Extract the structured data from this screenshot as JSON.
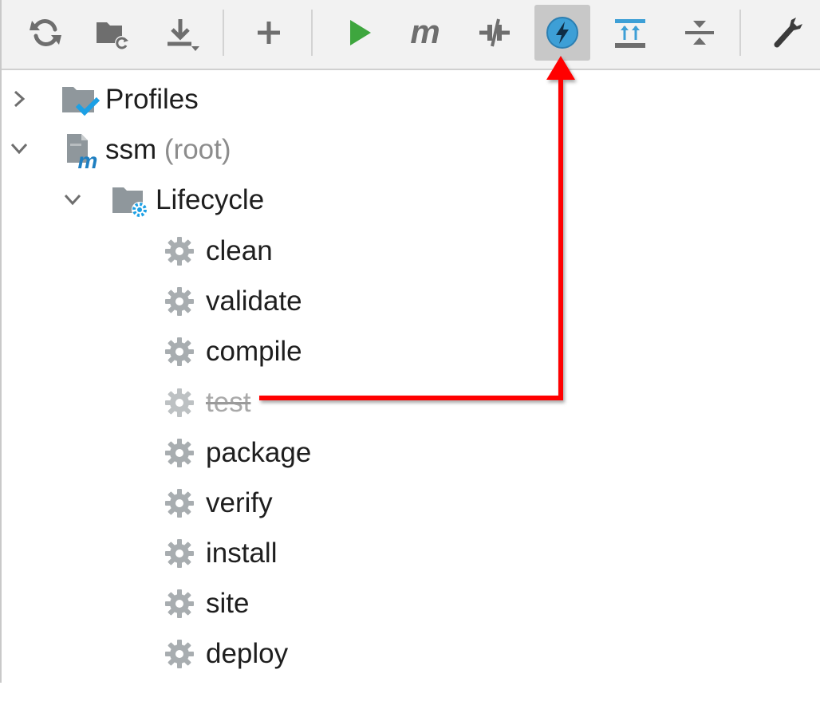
{
  "toolbar": {
    "buttons": [
      {
        "name": "reload-all-projects-button",
        "icon": "refresh-icon"
      },
      {
        "name": "generate-sources-button",
        "icon": "folder-refresh-icon"
      },
      {
        "name": "download-sources-button",
        "icon": "download-icon"
      },
      {
        "name": "add-project-button",
        "icon": "plus-icon"
      },
      {
        "name": "run-goal-button",
        "icon": "run-icon"
      },
      {
        "name": "execute-maven-goal-button",
        "icon": "maven-m-icon"
      },
      {
        "name": "toggle-offline-mode-button",
        "icon": "offline-icon"
      },
      {
        "name": "skip-tests-button",
        "icon": "lightning-icon",
        "active": true
      },
      {
        "name": "expand-all-button",
        "icon": "expand-all-icon"
      },
      {
        "name": "collapse-all-button",
        "icon": "collapse-all-icon"
      },
      {
        "name": "maven-settings-button",
        "icon": "wrench-icon"
      }
    ]
  },
  "tree": {
    "profiles": {
      "label": "Profiles",
      "expanded": false
    },
    "project": {
      "label": "ssm",
      "suffix": "(root)",
      "expanded": true
    },
    "lifecycle": {
      "label": "Lifecycle",
      "expanded": true
    },
    "goals": [
      {
        "label": "clean",
        "skipped": false
      },
      {
        "label": "validate",
        "skipped": false
      },
      {
        "label": "compile",
        "skipped": false
      },
      {
        "label": "test",
        "skipped": true
      },
      {
        "label": "package",
        "skipped": false
      },
      {
        "label": "verify",
        "skipped": false
      },
      {
        "label": "install",
        "skipped": false
      },
      {
        "label": "site",
        "skipped": false
      },
      {
        "label": "deploy",
        "skipped": false
      }
    ]
  },
  "colors": {
    "toolbar_bg": "#f2f2f2",
    "active_button_bg": "#c8c8c8",
    "run_green": "#3ea63e",
    "accent_blue": "#3d9fd6",
    "icon_gray": "#6e6e6e",
    "gear_gray": "#a8adb0",
    "annotation_red": "#ff0000"
  }
}
